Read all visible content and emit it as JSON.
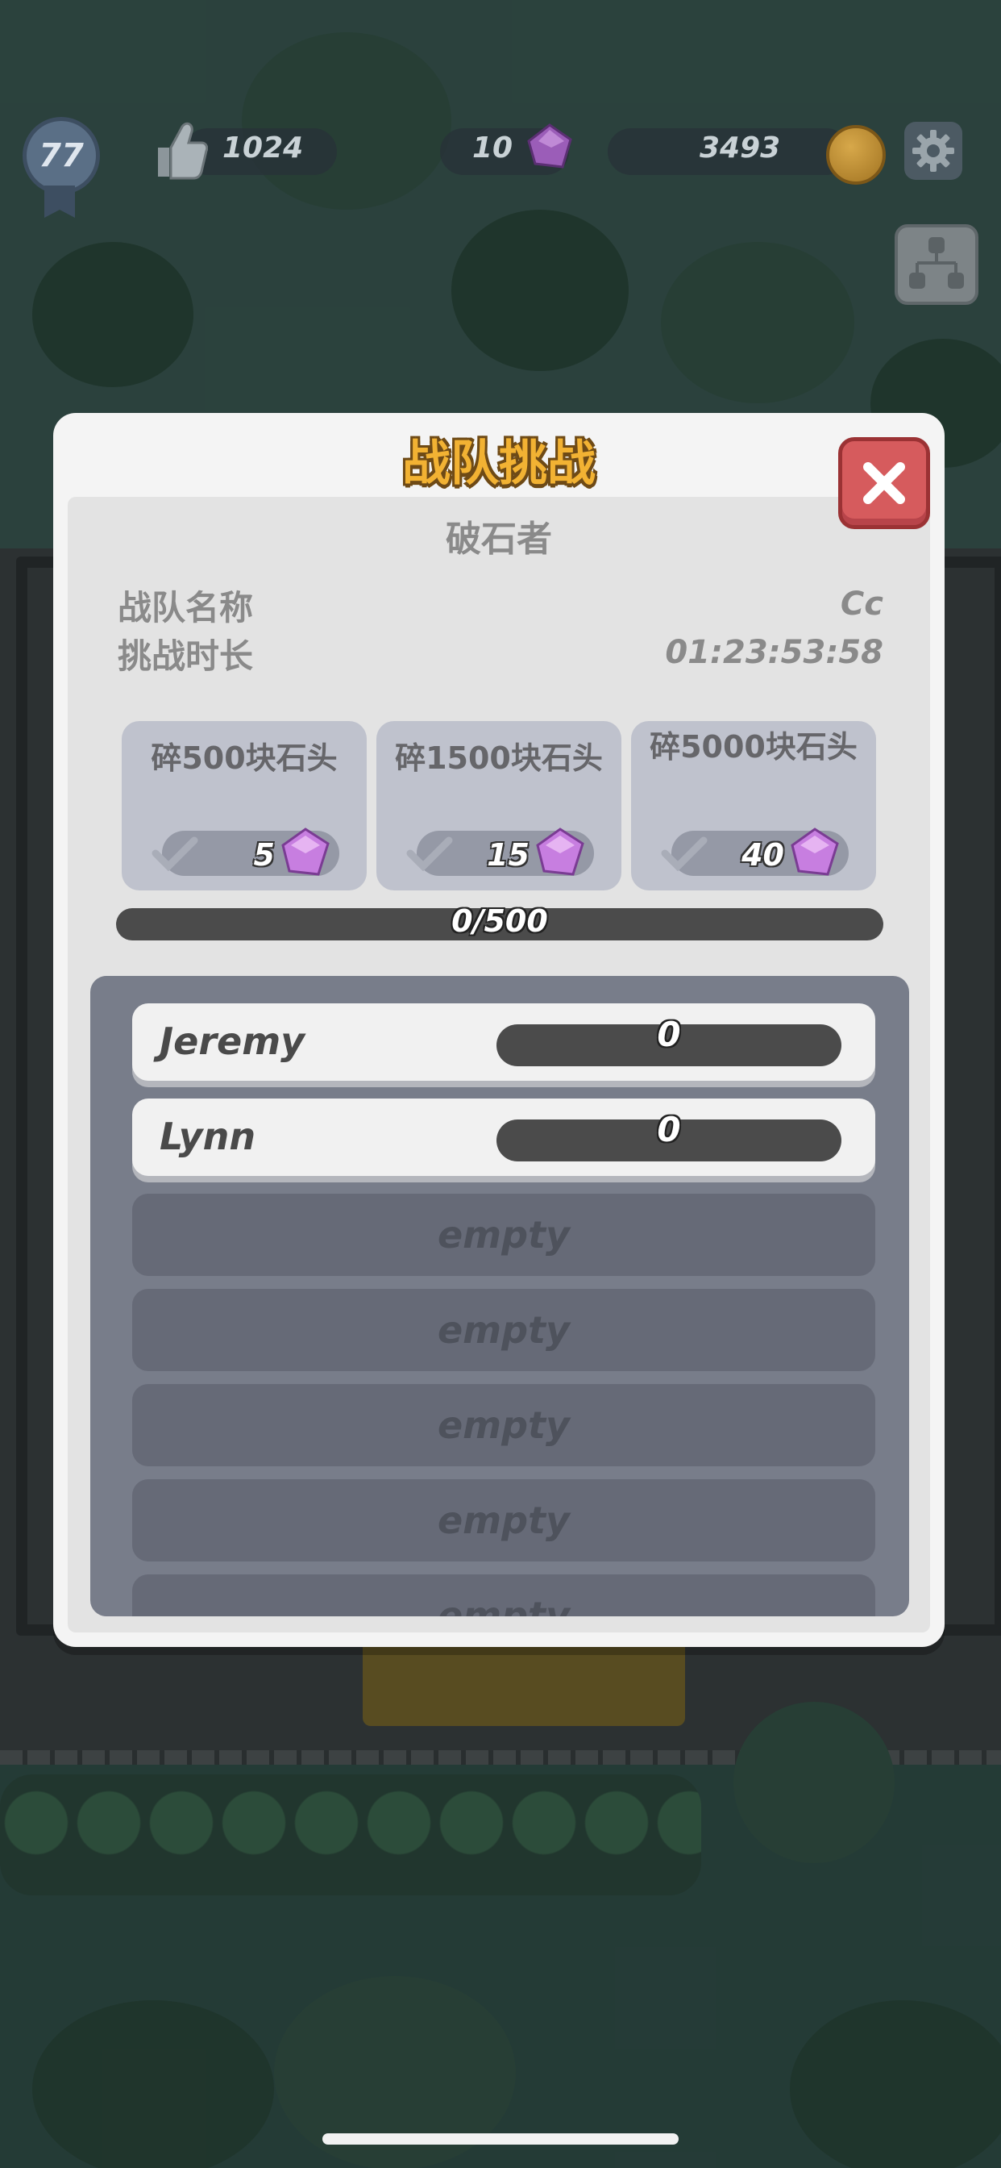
{
  "hud": {
    "level": "77",
    "likes": "1024",
    "gems": "10",
    "coins": "3493"
  },
  "modal": {
    "title": "战队挑战",
    "team_name": "破石者",
    "labels": {
      "team_name_label": "战队名称",
      "duration_label": "挑战时长"
    },
    "values": {
      "team_name_value": "Cc",
      "duration_value": "01:23:53:58"
    },
    "rewards": [
      {
        "label": "碎500块石头",
        "gems": "5"
      },
      {
        "label": "碎1500块石头",
        "gems": "15"
      },
      {
        "label": "碎5000块石头",
        "gems": "40"
      }
    ],
    "progress": {
      "text": "0/500",
      "fraction": 0
    },
    "members": [
      {
        "name": "Jeremy",
        "score": "0"
      },
      {
        "name": "Lynn",
        "score": "0"
      }
    ],
    "empty_label": "empty"
  },
  "colors": {
    "title_gold": "#f2b233",
    "close_red": "#d65b5d",
    "gem_purple": "#c77ee0",
    "panel_gray": "#787d8a"
  },
  "icons": [
    "thumbs-up-icon",
    "gem-icon",
    "coin-icon",
    "gear-icon",
    "team-tree-icon",
    "close-icon",
    "checkmark-icon"
  ]
}
